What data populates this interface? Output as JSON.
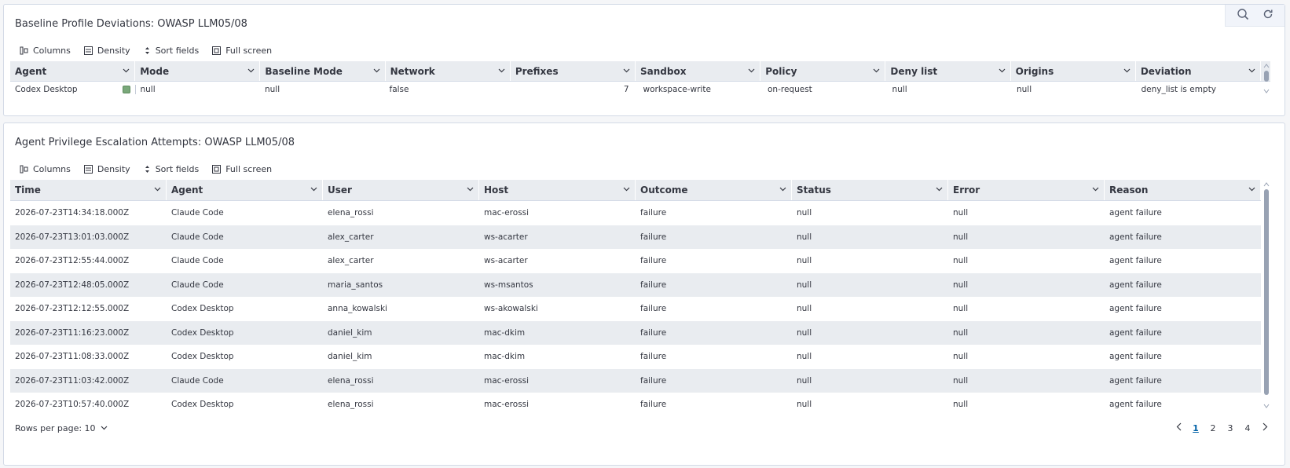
{
  "panel1": {
    "title": "Baseline Profile Deviations: OWASP LLM05/08",
    "toolbar": {
      "columns": "Columns",
      "density": "Density",
      "sort": "Sort fields",
      "fullscreen": "Full screen"
    },
    "headers": [
      "Agent",
      "Mode",
      "Baseline Mode",
      "Network",
      "Prefixes",
      "Sandbox",
      "Policy",
      "Deny list",
      "Origins",
      "Deviation"
    ],
    "rows": [
      {
        "agent": "Codex Desktop",
        "mode": "null",
        "baseline_mode": "null",
        "network": "false",
        "prefixes": "7",
        "sandbox": "workspace-write",
        "policy": "on-request",
        "deny_list": "null",
        "origins": "null",
        "deviation": "deny_list is empty"
      }
    ]
  },
  "panel2": {
    "title": "Agent Privilege Escalation Attempts: OWASP LLM05/08",
    "toolbar": {
      "columns": "Columns",
      "density": "Density",
      "sort": "Sort fields",
      "fullscreen": "Full screen"
    },
    "headers": [
      "Time",
      "Agent",
      "User",
      "Host",
      "Outcome",
      "Status",
      "Error",
      "Reason"
    ],
    "rows": [
      [
        "2026-07-23T14:34:18.000Z",
        "Claude Code",
        "elena_rossi",
        "mac-erossi",
        "failure",
        "null",
        "null",
        "agent failure"
      ],
      [
        "2026-07-23T13:01:03.000Z",
        "Claude Code",
        "alex_carter",
        "ws-acarter",
        "failure",
        "null",
        "null",
        "agent failure"
      ],
      [
        "2026-07-23T12:55:44.000Z",
        "Claude Code",
        "alex_carter",
        "ws-acarter",
        "failure",
        "null",
        "null",
        "agent failure"
      ],
      [
        "2026-07-23T12:48:05.000Z",
        "Claude Code",
        "maria_santos",
        "ws-msantos",
        "failure",
        "null",
        "null",
        "agent failure"
      ],
      [
        "2026-07-23T12:12:55.000Z",
        "Codex Desktop",
        "anna_kowalski",
        "ws-akowalski",
        "failure",
        "null",
        "null",
        "agent failure"
      ],
      [
        "2026-07-23T11:16:23.000Z",
        "Codex Desktop",
        "daniel_kim",
        "mac-dkim",
        "failure",
        "null",
        "null",
        "agent failure"
      ],
      [
        "2026-07-23T11:08:33.000Z",
        "Codex Desktop",
        "daniel_kim",
        "mac-dkim",
        "failure",
        "null",
        "null",
        "agent failure"
      ],
      [
        "2026-07-23T11:03:42.000Z",
        "Claude Code",
        "elena_rossi",
        "mac-erossi",
        "failure",
        "null",
        "null",
        "agent failure"
      ],
      [
        "2026-07-23T10:57:40.000Z",
        "Codex Desktop",
        "elena_rossi",
        "mac-erossi",
        "failure",
        "null",
        "null",
        "agent failure"
      ]
    ],
    "footer": {
      "rows_per_page": "Rows per page: 10",
      "pages": [
        "1",
        "2",
        "3",
        "4"
      ],
      "active_page": "1"
    }
  },
  "icons": {
    "search": "search-icon",
    "refresh": "refresh-icon",
    "columns": "columns-icon",
    "density": "density-icon",
    "sort": "sort-icon",
    "fullscreen": "fullscreen-icon",
    "chevron": "chevron-down-icon"
  },
  "colors": {
    "header_bg": "#e9ecf0",
    "alt_row": "#e9ecf0",
    "link": "#0061a6"
  }
}
